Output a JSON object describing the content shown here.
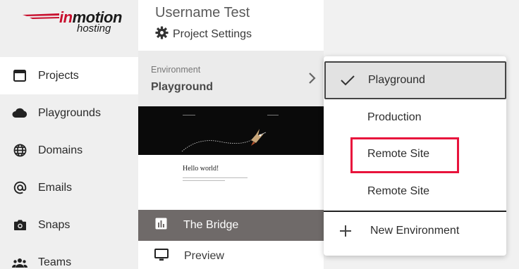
{
  "logo": {
    "brand_in": "in",
    "brand_rest": "motion",
    "sub": "hosting",
    "accent": "#c8102e"
  },
  "sidebar": {
    "items": [
      {
        "label": "Projects",
        "icon": "window-icon",
        "active": true
      },
      {
        "label": "Playgrounds",
        "icon": "cloud-icon",
        "active": false
      },
      {
        "label": "Domains",
        "icon": "globe-icon",
        "active": false
      },
      {
        "label": "Emails",
        "icon": "at-sign-icon",
        "active": false
      },
      {
        "label": "Snaps",
        "icon": "camera-icon",
        "active": false
      },
      {
        "label": "Teams",
        "icon": "people-icon",
        "active": false
      }
    ]
  },
  "project": {
    "user_name": "Username Test",
    "settings_label": "Project Settings",
    "environment_label": "Environment",
    "environment_value": "Playground",
    "thumbnail_heading": "Hello world!",
    "bridge_label": "The Bridge",
    "preview_label": "Preview"
  },
  "dropdown": {
    "items": [
      {
        "label": "Playground",
        "selected": true
      },
      {
        "label": "Production",
        "selected": false
      },
      {
        "label": "Remote Site",
        "selected": false,
        "highlighted": true
      },
      {
        "label": "Remote Site",
        "selected": false
      }
    ],
    "new_label": "New Environment",
    "highlight_color": "#e8143c"
  }
}
